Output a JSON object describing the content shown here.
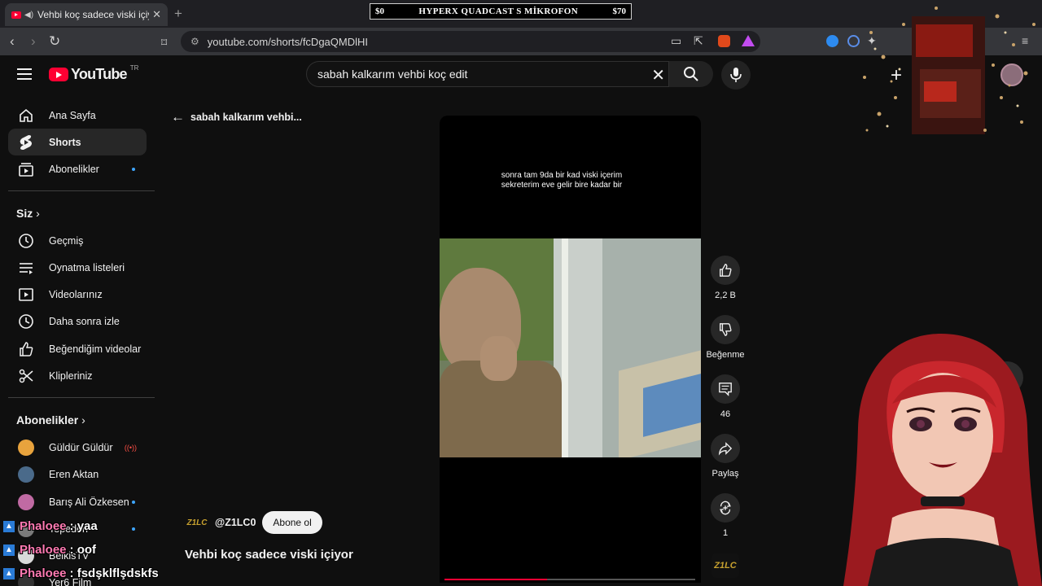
{
  "browser": {
    "tab_title": "Vehbi koç sadece viski içiyor",
    "address": "youtube.com/shorts/fcDgaQMDlHI"
  },
  "promo": {
    "left_price": "$0",
    "product": "HYPERX QUADCAST S MİKROFON",
    "right_price": "$70"
  },
  "youtube": {
    "logo_text": "YouTube",
    "country_code": "TR",
    "search_query": "sabah kalkarım vehbi koç edit"
  },
  "sidebar": {
    "main": [
      {
        "label": "Ana Sayfa",
        "icon": "home-icon"
      },
      {
        "label": "Shorts",
        "icon": "shorts-icon",
        "active": true
      },
      {
        "label": "Abonelikler",
        "icon": "subscriptions-icon",
        "dot": true
      }
    ],
    "you_header": "Siz",
    "you": [
      {
        "label": "Geçmiş",
        "icon": "history-icon"
      },
      {
        "label": "Oynatma listeleri",
        "icon": "playlists-icon"
      },
      {
        "label": "Videolarınız",
        "icon": "your-videos-icon"
      },
      {
        "label": "Daha sonra izle",
        "icon": "watch-later-icon"
      },
      {
        "label": "Beğendiğim videolar",
        "icon": "liked-icon"
      },
      {
        "label": "Klipleriniz",
        "icon": "clips-icon"
      }
    ],
    "subs_header": "Abonelikler",
    "subscriptions": [
      {
        "label": "Güldür Güldür",
        "color": "#e8a33d",
        "live": true
      },
      {
        "label": "Eren Aktan",
        "color": "#4a6a8a"
      },
      {
        "label": "Barış Ali Özkesen",
        "color": "#c06aa3",
        "dot": true
      },
      {
        "label": "Tepeden",
        "color": "#7a7a7a",
        "dot": true
      },
      {
        "label": "BelkisTV",
        "color": "#d9d9d9"
      },
      {
        "label": "Yer6 Film",
        "color": "#333333"
      }
    ]
  },
  "shorts": {
    "back_label": "sabah kalkarım vehbi...",
    "caption_line1": "sonra tam 9da bir kad viski içerim",
    "caption_line2": "sekreterim eve gelir bire kadar bir",
    "progress": 0.41,
    "like_count": "2,2 B",
    "dislike_label": "Beğenme",
    "comment_count": "46",
    "share_label": "Paylaş",
    "remix_count": "1",
    "channel_logo": "Z1LC",
    "channel_handle": "@Z1LC0",
    "subscribe_label": "Abone ol",
    "video_title": "Vehbi koç sadece viski içiyor"
  },
  "chat": [
    {
      "user": "Phaloee",
      "message": ": yaa"
    },
    {
      "user": "Phaloee",
      "message": ": oof"
    },
    {
      "user": "Phaloee",
      "message": ": fsdşklflşdskfs"
    }
  ],
  "colors": {
    "accent": "#ff0033",
    "bg": "#0f0f0f",
    "chip": "#272727",
    "dot": "#3ea6ff"
  }
}
